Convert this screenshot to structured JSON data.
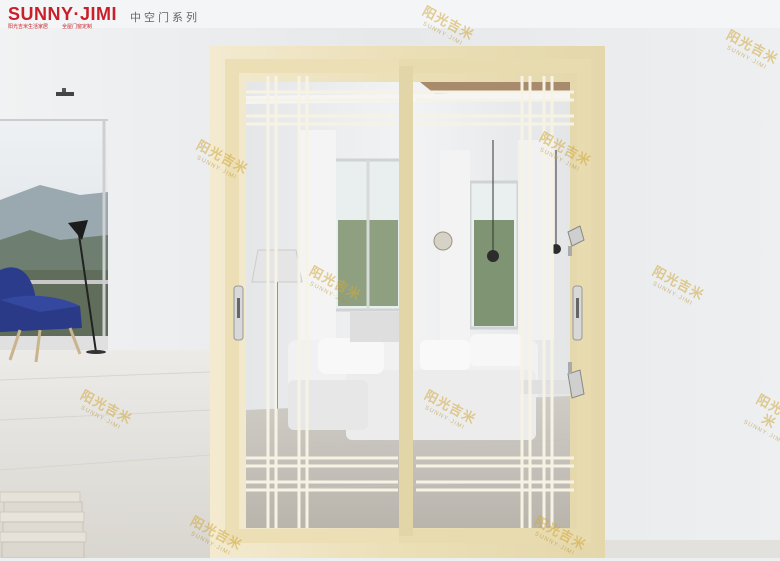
{
  "brand": {
    "name": "SUNNY·JIMI",
    "tagline_left": "阳光吉米生活家居",
    "tagline_right": "全屋门窗定制"
  },
  "series_title": "中空门系列",
  "watermark": {
    "text_cn": "阳光吉米",
    "text_en": "SUNNY·JIMI"
  },
  "colors": {
    "brand_red": "#c8202a",
    "frame": "#ede2bd",
    "wall": "#eceeef",
    "sofa": "#2b3c8c",
    "watermark": "#d2a93c"
  }
}
